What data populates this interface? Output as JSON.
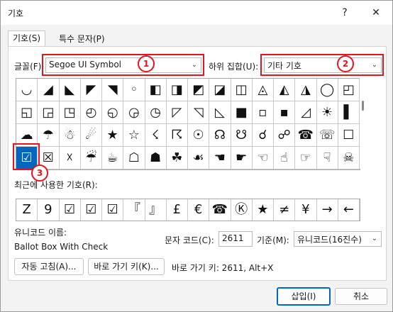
{
  "window": {
    "title": "기호",
    "help": "?",
    "close": "✕"
  },
  "tabs": [
    {
      "label": "기호(S)"
    },
    {
      "label": "특수 문자(P)"
    }
  ],
  "font": {
    "label": "글꼴(F):",
    "value": "Segoe UI Symbol"
  },
  "subset": {
    "label": "하위 집합(U):",
    "value": "기타 기호"
  },
  "badges": [
    "1",
    "2",
    "3"
  ],
  "symbols": [
    [
      "◡",
      "◢",
      "◣",
      "◤",
      "◥",
      "◦",
      "◧",
      "◨",
      "◩",
      "◪",
      "◫",
      "◬",
      "◭",
      "◮",
      "◯",
      "◰"
    ],
    [
      "◱",
      "◲",
      "◳",
      "◴",
      "◵",
      "◶",
      "◷",
      "◸",
      "◹",
      "◺",
      "■",
      "▫",
      "▪",
      "◿",
      "☀",
      "▌"
    ],
    [
      "☁",
      "☂",
      "☃",
      "☄",
      "★",
      "☆",
      "☇",
      "☈",
      "☉",
      "☊",
      "☋",
      "☌",
      "☍",
      "☎",
      "☏",
      "☐"
    ],
    [
      "☑",
      "☒",
      "☓",
      "☔",
      "☕",
      "☖",
      "☗",
      "☘",
      "☙",
      "☚",
      "☛",
      "☜",
      "☝",
      "☞",
      "☟",
      "☠"
    ]
  ],
  "recent": {
    "label": "최근에 사용한 기호(R):",
    "symbols": [
      "Z",
      "9",
      "☑",
      "☑",
      "☑",
      "『",
      "』",
      "£",
      "€",
      "☎",
      "Ⓚ",
      "★",
      "≠",
      "¥",
      "→",
      "←"
    ]
  },
  "unicode_name": {
    "label": "유니코드 이름:",
    "value": "Ballot Box With Check"
  },
  "char_code": {
    "label": "문자 코드(C):",
    "value": "2611"
  },
  "from": {
    "label": "기준(M):",
    "value": "유니코드(16진수)"
  },
  "buttons": {
    "autocorrect": "자동 고침(A)...",
    "shortcut_key": "바로 가기 키(K)...",
    "insert": "삽입(I)",
    "cancel": "취소"
  },
  "shortcut_text": "바로 가기 키: 2611, Alt+X"
}
